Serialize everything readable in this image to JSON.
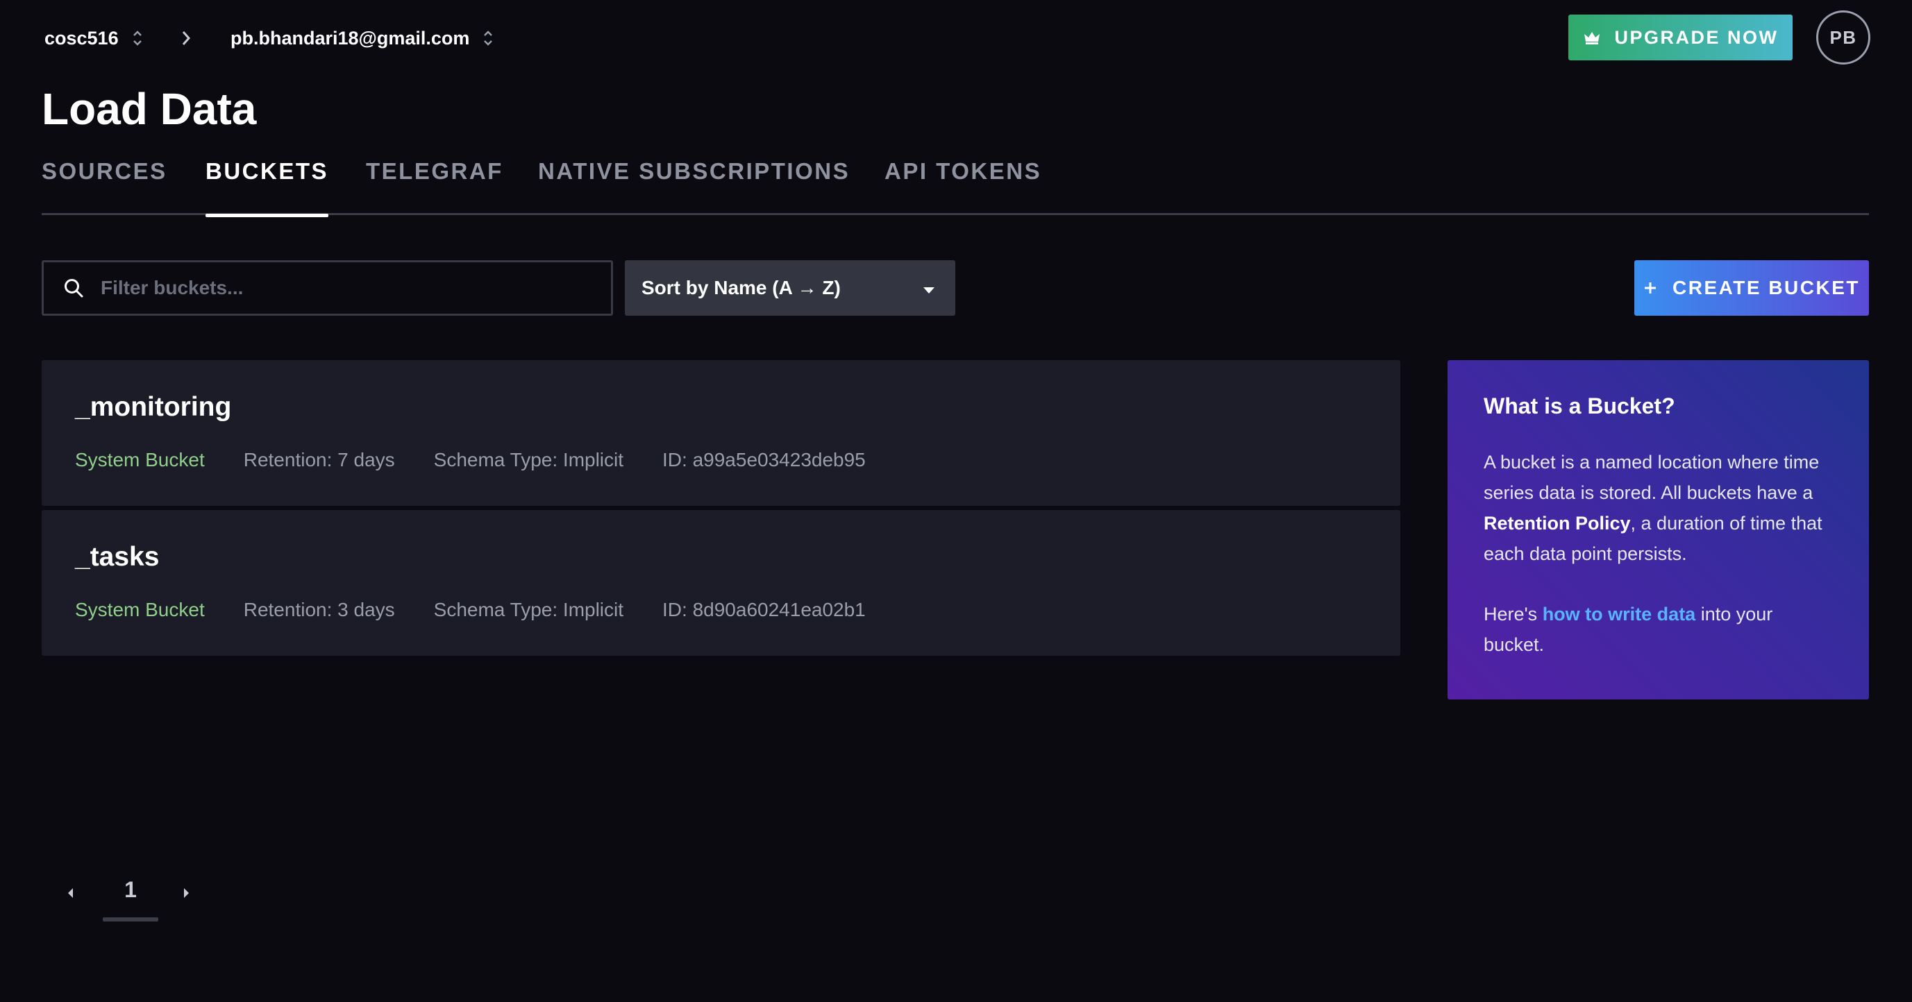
{
  "header": {
    "org": "cosc516",
    "user": "pb.bhandari18@gmail.com",
    "upgrade_label": "UPGRADE NOW",
    "avatar_initials": "PB"
  },
  "page": {
    "title": "Load Data"
  },
  "tabs": [
    {
      "label": "SOURCES",
      "active": false
    },
    {
      "label": "BUCKETS",
      "active": true
    },
    {
      "label": "TELEGRAF",
      "active": false
    },
    {
      "label": "NATIVE SUBSCRIPTIONS",
      "active": false
    },
    {
      "label": "API TOKENS",
      "active": false
    }
  ],
  "toolbar": {
    "search_placeholder": "Filter buckets...",
    "sort_label": "Sort by Name (A → Z)",
    "create_label": "CREATE BUCKET"
  },
  "buckets": [
    {
      "name": "_monitoring",
      "type": "System Bucket",
      "retention": "Retention: 7 days",
      "schema": "Schema Type: Implicit",
      "id": "ID: a99a5e03423deb95"
    },
    {
      "name": "_tasks",
      "type": "System Bucket",
      "retention": "Retention: 3 days",
      "schema": "Schema Type: Implicit",
      "id": "ID: 8d90a60241ea02b1"
    }
  ],
  "info": {
    "title": "What is a Bucket?",
    "p1_a": "A bucket is a named location where time series data is stored. All buckets have a ",
    "p1_bold": "Retention Policy",
    "p1_b": ", a duration of time that each data point persists.",
    "p2_a": "Here's ",
    "p2_link": "how to write data",
    "p2_b": " into your bucket."
  },
  "pagination": {
    "current": "1"
  },
  "colors": {
    "background": "#0a0a10",
    "card": "#1c1c28",
    "system_bucket": "#8fcf8a",
    "link": "#59b3ff",
    "upgrade_gradient": [
      "#2fa96a",
      "#4bb7cc"
    ],
    "create_gradient": [
      "#3a8ff0",
      "#5a4bd6"
    ]
  }
}
